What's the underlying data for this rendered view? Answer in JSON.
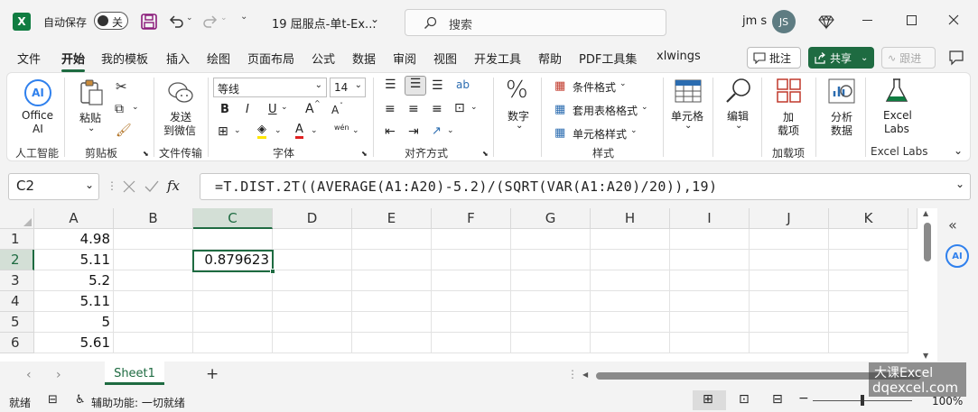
{
  "titlebar": {
    "autosave_label": "自动保存",
    "autosave_state": "关",
    "filename": "19 屈服点-单t-Ex...",
    "search_placeholder": "搜索",
    "user": "jm s",
    "user_initials": "JS"
  },
  "tabs": [
    "文件",
    "开始",
    "我的模板",
    "插入",
    "绘图",
    "页面布局",
    "公式",
    "数据",
    "审阅",
    "视图",
    "开发工具",
    "帮助",
    "PDF工具集",
    "xlwings"
  ],
  "active_tab": "开始",
  "header_buttons": {
    "comments": "批注",
    "share": "共享",
    "follow": "跟进"
  },
  "ribbon": {
    "office_ai": {
      "top": "Office",
      "bottom": "AI",
      "group": "人工智能"
    },
    "clipboard": {
      "paste": "粘贴",
      "group": "剪贴板"
    },
    "wechat": {
      "top": "发送",
      "bottom": "到微信",
      "group": "文件传输"
    },
    "font": {
      "name": "等线",
      "size": "14",
      "bold": "B",
      "italic": "I",
      "underline": "U",
      "grow": "A",
      "shrink": "A",
      "wen": "wén",
      "group": "字体"
    },
    "alignment": {
      "group": "对齐方式"
    },
    "number": {
      "label": "数字"
    },
    "styles": {
      "conditional": "条件格式",
      "table": "套用表格格式",
      "cell": "单元格样式",
      "group": "样式"
    },
    "cells": {
      "label": "单元格"
    },
    "editing": {
      "label": "编辑"
    },
    "addins": {
      "top": "加",
      "bottom": "载项",
      "group": "加载项"
    },
    "analysis": {
      "top": "分析",
      "bottom": "数据"
    },
    "excel_labs": {
      "top": "Excel",
      "bottom": "Labs",
      "group": "Excel Labs"
    }
  },
  "formula_bar": {
    "name_box": "C2",
    "fx": "fx",
    "formula": "=T.DIST.2T((AVERAGE(A1:A20)-5.2)/(SQRT(VAR(A1:A20)/20)),19)"
  },
  "columns": [
    "A",
    "B",
    "C",
    "D",
    "E",
    "F",
    "G",
    "H",
    "I",
    "J",
    "K"
  ],
  "rows": [
    {
      "num": "1",
      "a": "4.98",
      "c": ""
    },
    {
      "num": "2",
      "a": "5.11",
      "c": "0.879623"
    },
    {
      "num": "3",
      "a": "5.2",
      "c": ""
    },
    {
      "num": "4",
      "a": "5.11",
      "c": ""
    },
    {
      "num": "5",
      "a": "5",
      "c": ""
    },
    {
      "num": "6",
      "a": "5.61",
      "c": ""
    }
  ],
  "sheet": {
    "name": "Sheet1",
    "add": "+"
  },
  "status": {
    "ready": "就绪",
    "accessibility": "辅助功能: 一切就绪",
    "zoom": "100%"
  },
  "watermark": {
    "line1": "大课Excel",
    "line2": "dqexcel.com"
  },
  "colors": {
    "accent": "#1e6b41",
    "selection": "#217346",
    "excel_green": "#107c41"
  }
}
